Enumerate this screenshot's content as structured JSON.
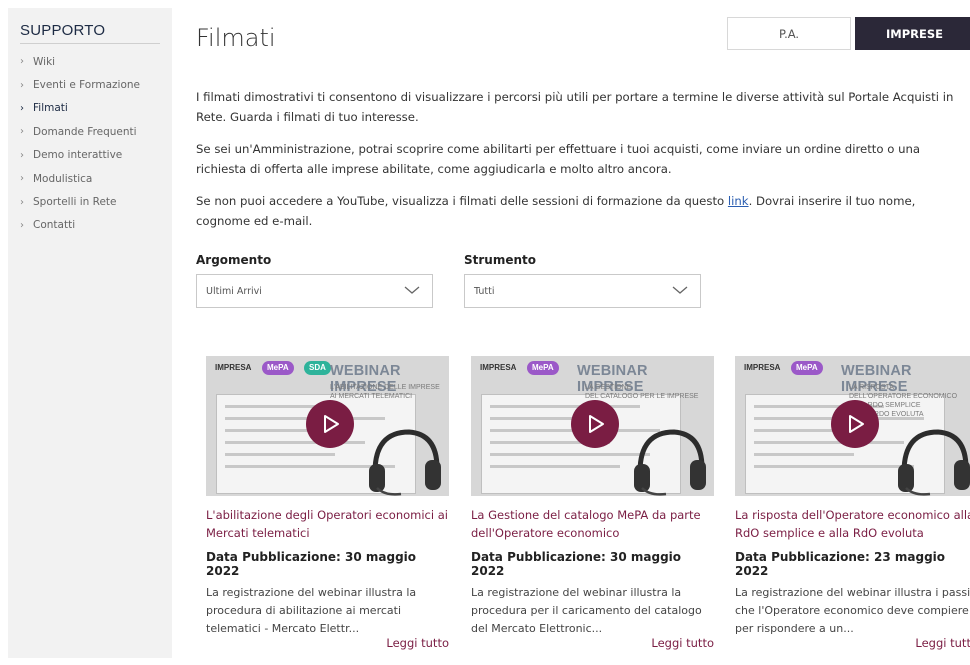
{
  "sidebar": {
    "title": "SUPPORTO",
    "items": [
      {
        "label": "Wiki"
      },
      {
        "label": "Eventi e Formazione"
      },
      {
        "label": "Filmati"
      },
      {
        "label": "Domande Frequenti"
      },
      {
        "label": "Demo interattive"
      },
      {
        "label": "Modulistica"
      },
      {
        "label": "Sportelli in Rete"
      },
      {
        "label": "Contatti"
      }
    ]
  },
  "header": {
    "title": "Filmati",
    "toggle_pa": "P.A.",
    "toggle_imprese": "IMPRESE"
  },
  "intro": {
    "p1": "I filmati dimostrativi ti consentono di visualizzare i percorsi più utili per portare a termine le diverse attività sul Portale Acquisti in Rete. Guarda i filmati di tuo interesse.",
    "p2": "Se sei un'Amministrazione, potrai scoprire come abilitarti per effettuare i tuoi acquisti, come inviare un ordine diretto o una richiesta di offerta alle imprese abilitate, come aggiudicarla e molto altro ancora.",
    "p3_before": "Se non puoi accedere a YouTube, visualizza i filmati delle sessioni di formazione da questo ",
    "p3_link": "link",
    "p3_after": ". Dovrai inserire il tuo nome, cognome ed e-mail."
  },
  "filters": {
    "argomento_label": "Argomento",
    "argomento_value": "Ultimi Arrivi",
    "strumento_label": "Strumento",
    "strumento_value": "Tutti"
  },
  "cards": [
    {
      "thumb": {
        "impresa": "IMPRESA",
        "mepa": "MePA",
        "sda": "SDA",
        "heading": "WEBINAR IMPRESE",
        "sub1": "L'ABILITAZIONE DELLE IMPRESE",
        "sub2": "AI MERCATI TELEMATICI"
      },
      "title": "L'abilitazione degli Operatori economici ai Mercati telematici",
      "date": "Data Pubblicazione: 30 maggio 2022",
      "desc": "La registrazione del webinar illustra la procedura di abilitazione ai mercati telematici - Mercato Elettr...",
      "more": "Leggi tutto"
    },
    {
      "thumb": {
        "impresa": "IMPRESA",
        "mepa": "MePA",
        "heading": "WEBINAR IMPRESE",
        "sub1": "LA GESTIONE",
        "sub2": "DEL CATALOGO PER LE IMPRESE"
      },
      "title": "La Gestione del catalogo MePA da parte dell'Operatore economico",
      "date": "Data Pubblicazione: 30 maggio 2022",
      "desc": "La registrazione del webinar illustra la procedura per il caricamento del catalogo del Mercato Elettronic...",
      "more": "Leggi tutto"
    },
    {
      "thumb": {
        "impresa": "IMPRESA",
        "mepa": "MePA",
        "heading": "WEBINAR IMPRESE",
        "sub1": "LA RISPOSTA",
        "sub2": "DELL'OPERATORE ECONOMICO",
        "sub3": "ALLA RDO SEMPLICE",
        "sub4": "E ALLA RDO EVOLUTA"
      },
      "title": "La risposta dell'Operatore economico alla RdO semplice e alla RdO evoluta",
      "date": "Data Pubblicazione: 23 maggio 2022",
      "desc": "La registrazione del webinar illustra i passi che l'Operatore economico deve compiere per rispondere a un...",
      "more": "Leggi tutto"
    }
  ]
}
